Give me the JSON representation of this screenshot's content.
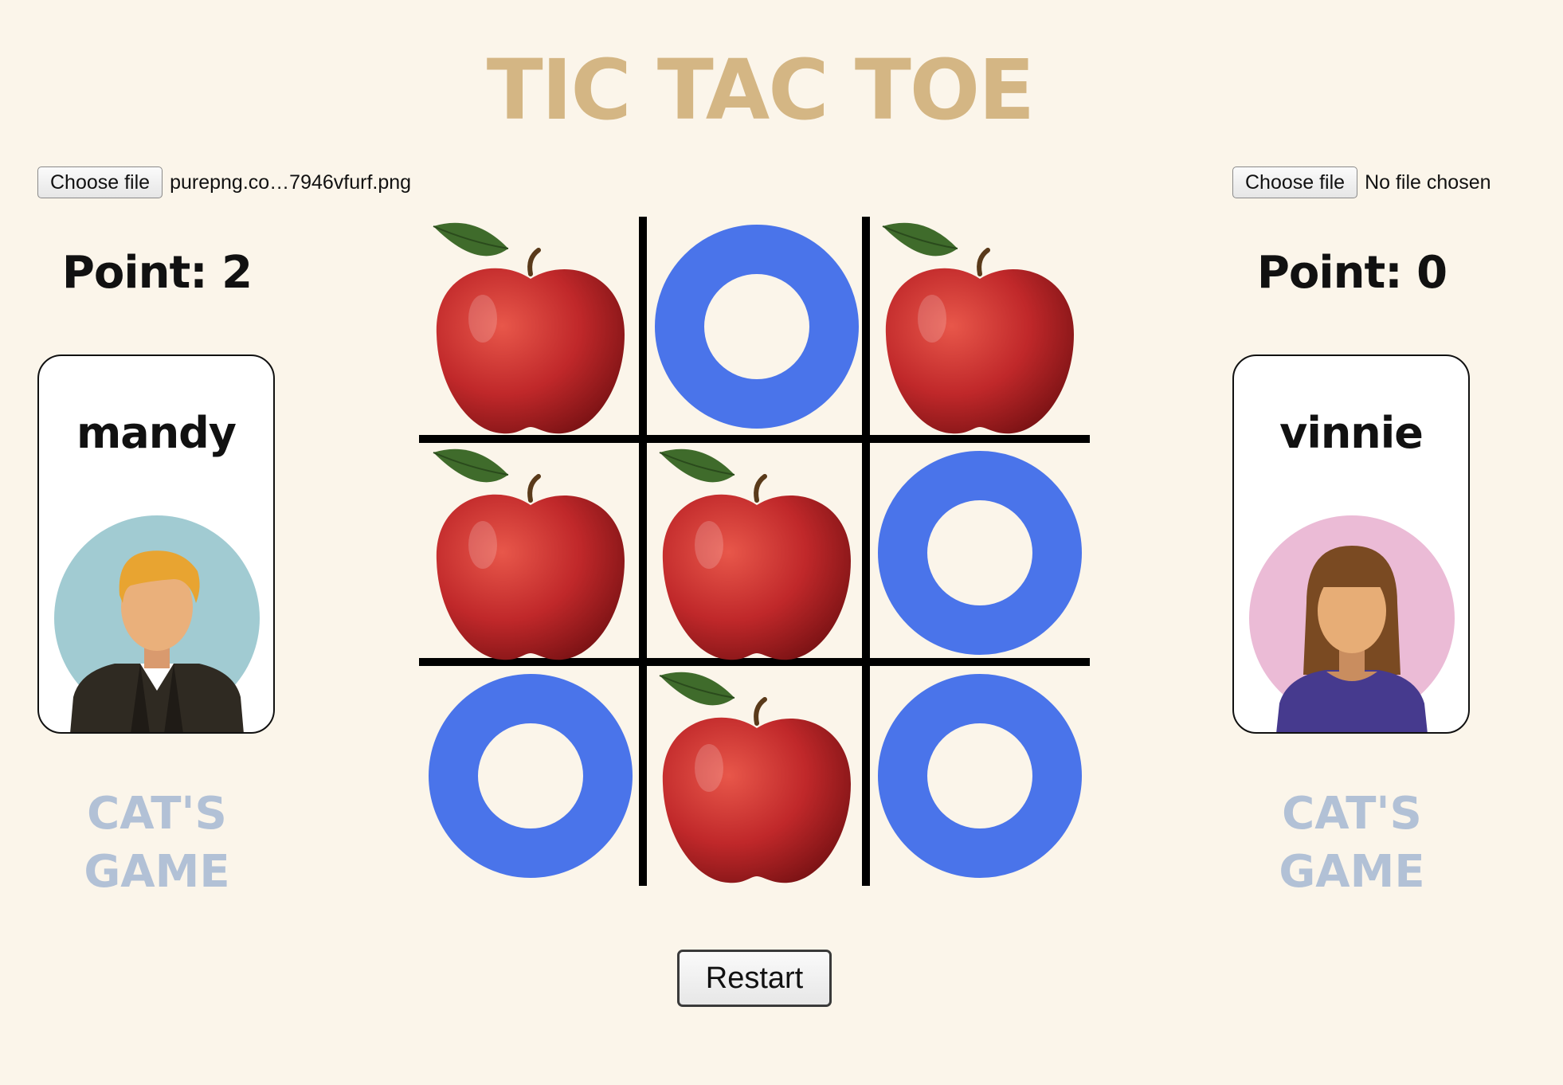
{
  "title": "TIC TAC TOE",
  "players": [
    {
      "file_button_label": "Choose file",
      "file_name": "purepng.co…7946vfurf.png",
      "points_label": "Point: 2",
      "name": "mandy",
      "avatar": "man-avatar",
      "status": [
        "CAT'S",
        "GAME"
      ]
    },
    {
      "file_button_label": "Choose file",
      "file_name": "No file chosen",
      "points_label": "Point: 0",
      "name": "vinnie",
      "avatar": "woman-avatar",
      "status": [
        "CAT'S",
        "GAME"
      ]
    }
  ],
  "board": [
    [
      "apple",
      "ring",
      "apple"
    ],
    [
      "apple",
      "apple",
      "ring"
    ],
    [
      "ring",
      "apple",
      "ring"
    ]
  ],
  "restart_label": "Restart",
  "colors": {
    "background": "#fbf5ea",
    "title": "#d4b684",
    "status": "#b2c1d6",
    "ring": "#4a74ea",
    "grid": "#000000",
    "apple": "#c0282a",
    "leaf": "#3f6b2b"
  }
}
